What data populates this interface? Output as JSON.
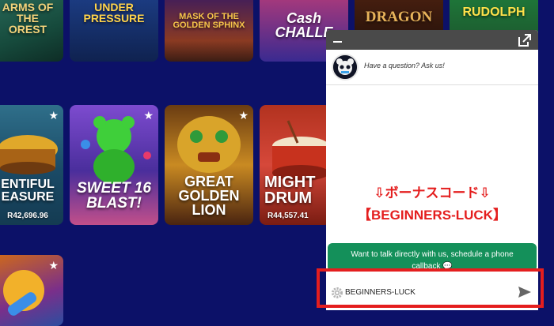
{
  "games": {
    "top": [
      {
        "title": "ARMS OF THE\nOREST"
      },
      {
        "title": "UNDER\nPRESSURE"
      },
      {
        "title": "MASK OF THE\nGOLDEN SPHINX"
      },
      {
        "title": "Cash\nCHALLE"
      },
      {
        "title": "DRAGON"
      },
      {
        "title": "RUDOLPH"
      }
    ],
    "middle": [
      {
        "title": "ENTIFUL\nEASURE",
        "jackpot": "R42,696.96"
      },
      {
        "title": "SWEET 16\nBLAST!",
        "jackpot": ""
      },
      {
        "title": "GREAT\nGOLDEN\nLION",
        "jackpot": ""
      },
      {
        "title": "MIGHT\nDRUM",
        "jackpot": "R44,557.41"
      }
    ]
  },
  "chat": {
    "question": "Have a question? Ask us!",
    "callout_line1": "⇩ボーナスコード⇩",
    "callout_line2": "【BEGINNERS-LUCK】",
    "cta": "Want to talk directly with us, schedule a phone callback 💬",
    "input_value": "BEGINNERS-LUCK"
  },
  "colors": {
    "background": "#0c1168",
    "chat_header": "#4a4a4a",
    "cta_green": "#14905a",
    "highlight_red": "#e41e1e"
  }
}
